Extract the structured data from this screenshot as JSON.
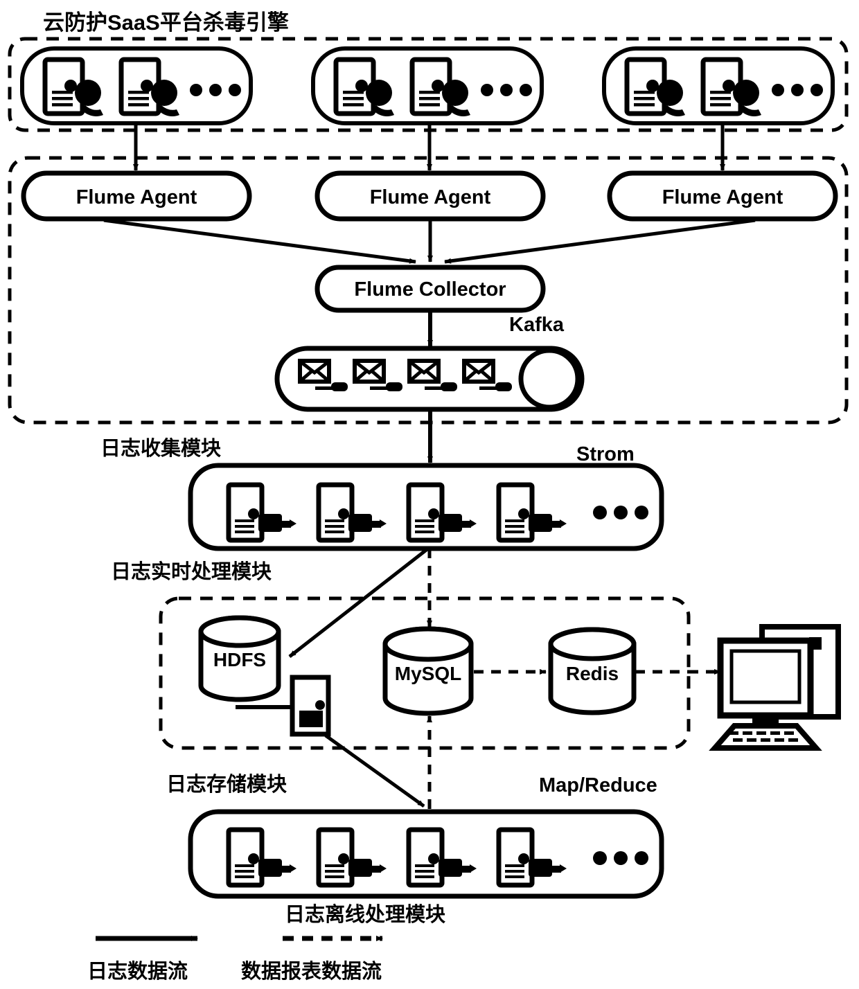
{
  "diagram": {
    "title": "云防护SaaS平台杀毒引擎",
    "colors": {
      "stroke": "#000000",
      "fill": "#ffffff",
      "background": "#ffffff"
    },
    "groups": {
      "saas_platform": {
        "label": "云防护SaaS平台杀毒引擎",
        "node_count": 3,
        "ellipsis": "• • •"
      },
      "log_collect": {
        "label": "日志收集模块"
      },
      "log_realtime": {
        "label": "日志实时处理模块",
        "engine": "Strom"
      },
      "log_storage": {
        "label": "日志存储模块"
      },
      "log_offline": {
        "label": "日志离线处理模块",
        "engine": "Map/Reduce"
      }
    },
    "nodes": {
      "flume_agent_1": "Flume Agent",
      "flume_agent_2": "Flume Agent",
      "flume_agent_3": "Flume Agent",
      "flume_collector": "Flume Collector",
      "kafka": "Kafka",
      "hdfs": "HDFS",
      "mysql": "MySQL",
      "redis": "Redis"
    },
    "legend": {
      "solid_label": "日志数据流",
      "dashed_label": "数据报表数据流"
    }
  }
}
